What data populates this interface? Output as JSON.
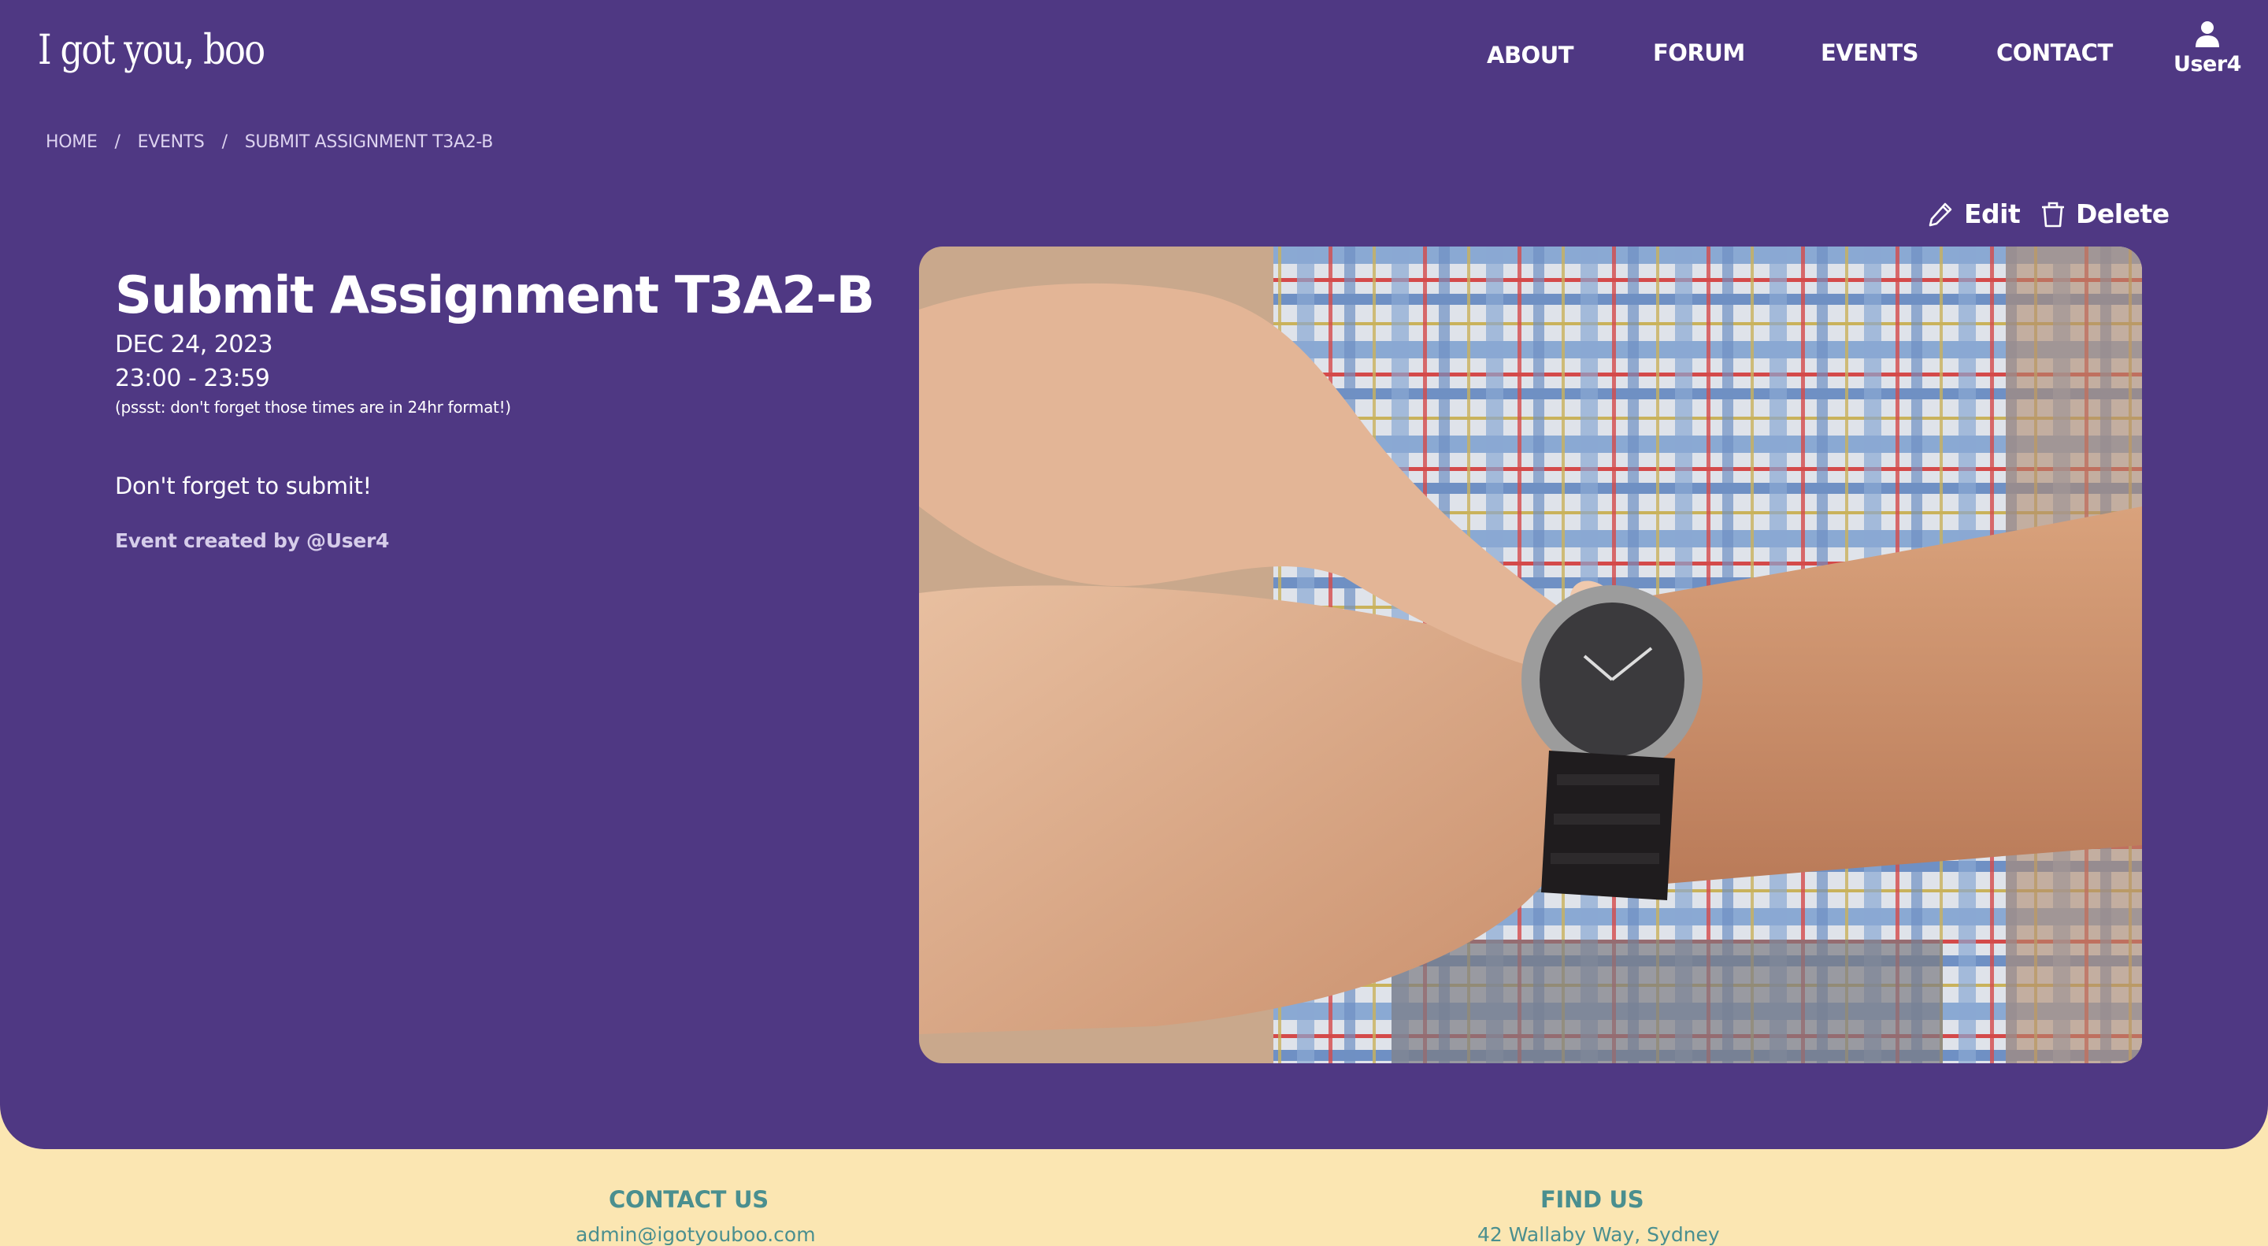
{
  "brand": "I got you, boo",
  "nav": {
    "about": "ABOUT",
    "forum": "FORUM",
    "events": "EVENTS",
    "contact": "CONTACT",
    "user": "User4"
  },
  "breadcrumb": {
    "home": "HOME",
    "events": "EVENTS",
    "current": "SUBMIT ASSIGNMENT T3A2-B",
    "separator": "/"
  },
  "actions": {
    "edit": "Edit",
    "delete": "Delete"
  },
  "event": {
    "title": "Submit Assignment T3A2-B",
    "date": "DEC 24, 2023",
    "time": "23:00 - 23:59",
    "note": "(pssst: don't forget those times are in 24hr format!)",
    "description": "Don't forget to submit!",
    "creator": "Event created by @User4"
  },
  "footer": {
    "contact_heading": "CONTACT US",
    "contact_email": "admin@igotyouboo.com",
    "find_heading": "FIND US",
    "address": "42 Wallaby Way, Sydney"
  },
  "colors": {
    "panel": "#4f3883",
    "footer_bg": "#fbe6b2",
    "footer_text": "#4a8f8f"
  },
  "icons": {
    "edit": "pencil-icon",
    "delete": "trash-icon",
    "user": "user-icon"
  }
}
